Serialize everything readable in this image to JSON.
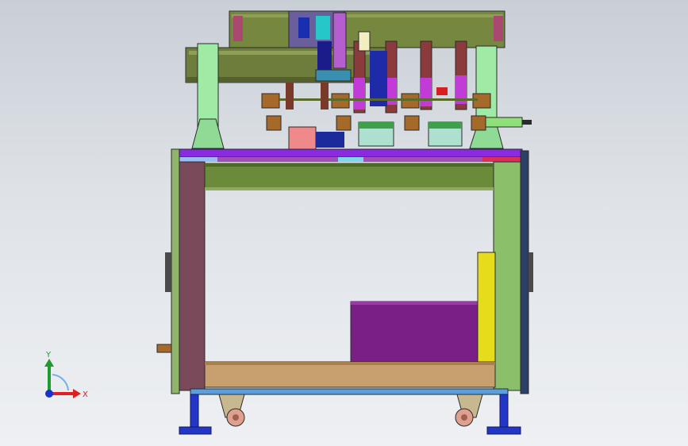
{
  "viewport": {
    "view_name": "front-view",
    "background_top": "#c9cfd6",
    "background_bottom": "#eef0f3"
  },
  "triad": {
    "x_label": "X",
    "y_label": "Y",
    "x_color": "#e02020",
    "y_color": "#1f9a2e",
    "origin_color": "#1a2fd0"
  },
  "model": {
    "frame_color": "#8fb56a",
    "tabletop_color": "#8a2be2",
    "left_leg_color": "#7a4a5a",
    "right_leg_color": "#8cbf6a",
    "top_beam_color": "#6b7a3a",
    "base_shelf_color": "#c8a070",
    "bottom_rail_color": "#5aa0e0",
    "cabinet_color": "#7a1f86",
    "yellow_panel_color": "#e6dc1c",
    "foot_color": "#2436c8",
    "caster_color": "#e0a090"
  }
}
